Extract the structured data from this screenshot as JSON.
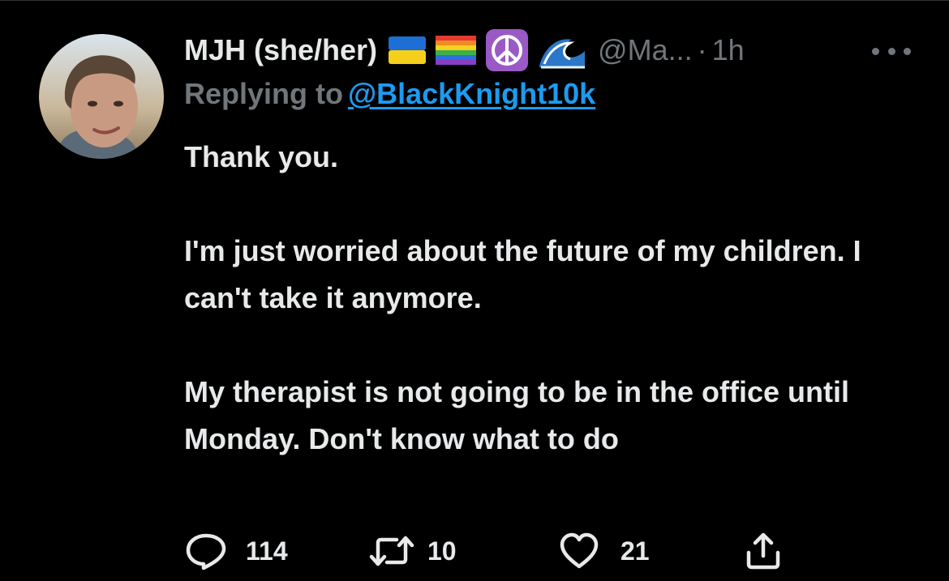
{
  "tweet": {
    "display_name": "MJH (she/her)",
    "badges": [
      "ukraine-flag-icon",
      "rainbow-flag-icon",
      "peace-symbol-icon",
      "wave-icon"
    ],
    "handle": "@Ma...",
    "separator": "·",
    "timestamp": "1h",
    "reply_prefix": "Replying to",
    "reply_to": "@BlackKnight10k",
    "text": {
      "paragraph_1": "Thank you.",
      "paragraph_2": "I'm just worried about the future of my children. I can't take it anymore.",
      "paragraph_3": "My therapist is not going to be in the office until Monday. Don't know what to do"
    },
    "actions": {
      "reply_count": "114",
      "retweet_count": "10",
      "like_count": "21"
    }
  },
  "colors": {
    "background": "#000000",
    "text_primary": "#e7e9ea",
    "text_secondary": "#71767b",
    "link": "#1d9bf0"
  },
  "icons": {
    "more": "more-horizontal-icon",
    "reply": "reply-bubble-icon",
    "retweet": "retweet-icon",
    "like": "heart-icon",
    "share": "share-icon"
  }
}
